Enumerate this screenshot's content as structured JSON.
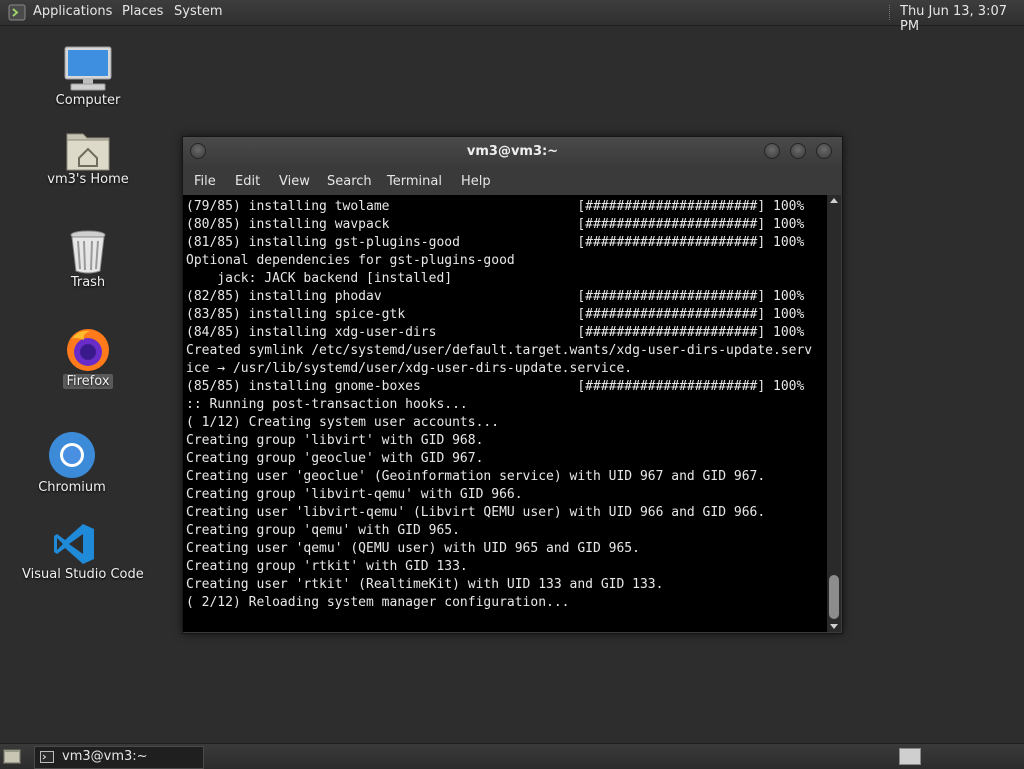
{
  "top_panel": {
    "applications": "Applications",
    "places": "Places",
    "system": "System",
    "clock": "Thu Jun 13,  3:07 PM"
  },
  "desktop_icons": {
    "computer": "Computer",
    "home": "vm3's Home",
    "trash": "Trash",
    "firefox": "Firefox",
    "chromium": "Chromium",
    "vscode": "Visual Studio Code"
  },
  "terminal": {
    "title": "vm3@vm3:~",
    "menu": {
      "file": "File",
      "edit": "Edit",
      "view": "View",
      "search": "Search",
      "terminal": "Terminal",
      "help": "Help"
    },
    "lines": [
      "(79/85) installing twolame                        [######################] 100%",
      "(80/85) installing wavpack                        [######################] 100%",
      "(81/85) installing gst-plugins-good               [######################] 100%",
      "Optional dependencies for gst-plugins-good",
      "    jack: JACK backend [installed]",
      "(82/85) installing phodav                         [######################] 100%",
      "(83/85) installing spice-gtk                      [######################] 100%",
      "(84/85) installing xdg-user-dirs                  [######################] 100%",
      "Created symlink /etc/systemd/user/default.target.wants/xdg-user-dirs-update.serv",
      "ice → /usr/lib/systemd/user/xdg-user-dirs-update.service.",
      "(85/85) installing gnome-boxes                    [######################] 100%",
      ":: Running post-transaction hooks...",
      "( 1/12) Creating system user accounts...",
      "Creating group 'libvirt' with GID 968.",
      "Creating group 'geoclue' with GID 967.",
      "Creating user 'geoclue' (Geoinformation service) with UID 967 and GID 967.",
      "Creating group 'libvirt-qemu' with GID 966.",
      "Creating user 'libvirt-qemu' (Libvirt QEMU user) with UID 966 and GID 966.",
      "Creating group 'qemu' with GID 965.",
      "Creating user 'qemu' (QEMU user) with UID 965 and GID 965.",
      "Creating group 'rtkit' with GID 133.",
      "Creating user 'rtkit' (RealtimeKit) with UID 133 and GID 133.",
      "( 2/12) Reloading system manager configuration..."
    ]
  },
  "bottom_panel": {
    "task_label": "vm3@vm3:~"
  }
}
